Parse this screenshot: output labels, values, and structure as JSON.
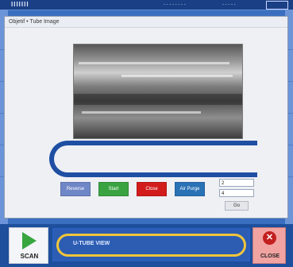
{
  "app": {
    "header_title": "IIIIIII",
    "header_mid": "- - - - - - - -",
    "header_right": "- - - - -"
  },
  "dialog": {
    "title": "Objetif • Tube Image",
    "buttons": {
      "reverse": "Reverse",
      "start": "Start",
      "close": "Close",
      "air_purge": "Air Purge",
      "go": "Go"
    },
    "fields": {
      "value1": "2",
      "value2": "4"
    }
  },
  "bottom": {
    "scan_label": "SCAN",
    "status_text": "U-TUBE VIEW",
    "close_label": "CLOSE"
  },
  "icons": {
    "scan": "play-triangle-icon",
    "close": "close-x-icon"
  },
  "colors": {
    "accent_blue": "#1f4fa3",
    "start_green": "#3aa341",
    "close_red": "#d21c1c",
    "status_yellow": "#f1c63a"
  }
}
